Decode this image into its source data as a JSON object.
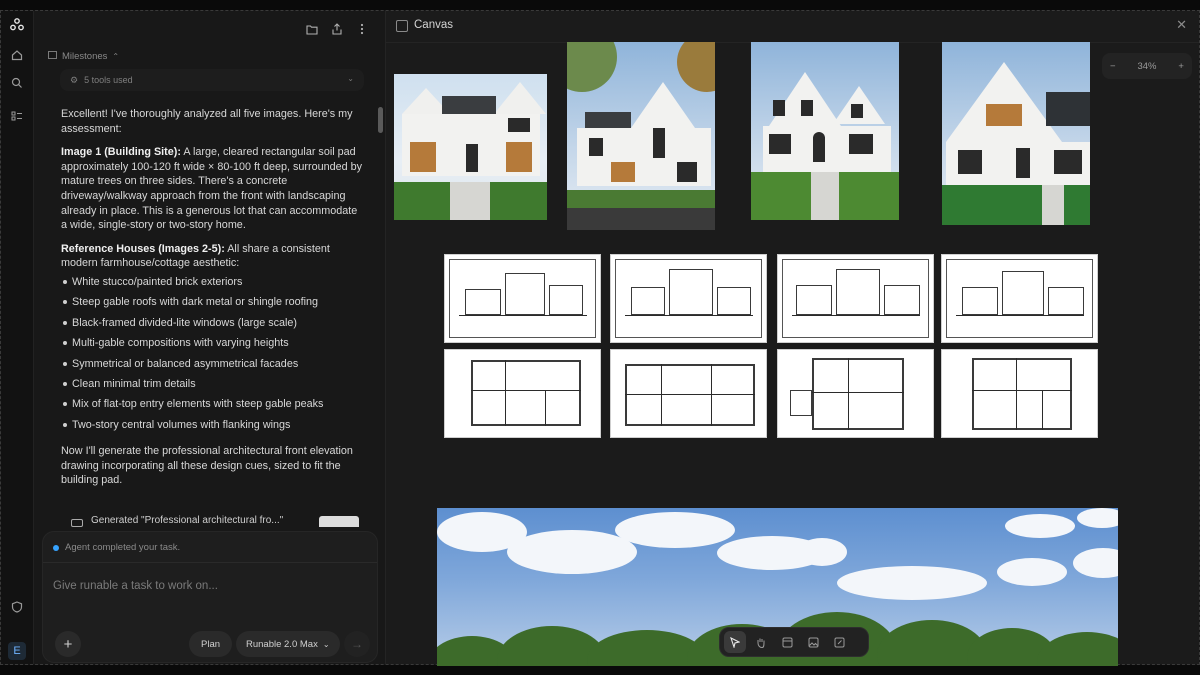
{
  "rail": {
    "logo_icon": "runable-logo-icon",
    "items": [
      "home-icon",
      "search-icon",
      "tasks-icon"
    ],
    "bottom": [
      "shield-icon"
    ],
    "avatar_letter": "E"
  },
  "chat": {
    "header_icons": [
      "folder-icon",
      "share-icon",
      "more-icon"
    ],
    "milestones_label": "Milestones",
    "tools_used": "5 tools used",
    "paragraphs": {
      "intro": "Excellent! I've thoroughly analyzed all five images. Here's my assessment:",
      "image1_title": "Image 1 (Building Site):",
      "image1_body": " A large, cleared rectangular soil pad approximately 100-120 ft wide × 80-100 ft deep, surrounded by mature trees on three sides. There's a concrete driveway/walkway approach from the front with landscaping already in place. This is a generous lot that can accommodate a wide, single-story or two-story home.",
      "ref_title": "Reference Houses (Images 2-5):",
      "ref_body": " All share a consistent modern farmhouse/cottage aesthetic:",
      "outro": "Now I'll generate the professional architectural front elevation drawing incorporating all these design cues, sized to fit the building pad."
    },
    "bullets": [
      "White stucco/painted brick exteriors",
      "Steep gable roofs with dark metal or shingle roofing",
      "Black-framed divided-lite windows (large scale)",
      "Multi-gable compositions with varying heights",
      "Symmetrical or balanced asymmetrical facades",
      "Clean minimal trim details",
      "Mix of flat-top entry elements with steep gable peaks",
      "Two-story central volumes with flanking wings"
    ],
    "generated_row": "Generated \"Professional architectural fro...\"",
    "status": "Agent completed your task.",
    "input_placeholder": "Give runable a task to work on...",
    "plan_label": "Plan",
    "model_label": "Runable 2.0 Max",
    "accent": "#36a3ff"
  },
  "canvas": {
    "title": "Canvas",
    "zoom_minus": "−",
    "zoom_value": "34%",
    "zoom_plus": "+",
    "toolbar_icons": [
      "pointer-icon",
      "hand-icon",
      "frame-icon",
      "image-icon",
      "edit-image-icon"
    ]
  }
}
